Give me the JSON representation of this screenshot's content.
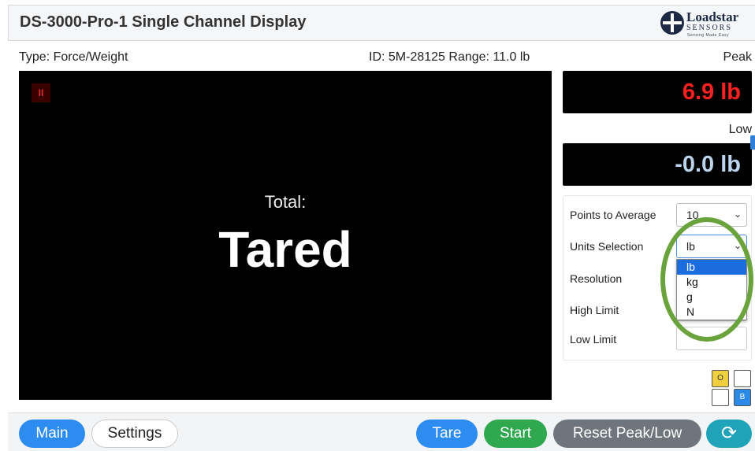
{
  "header": {
    "title": "DS-3000-Pro-1 Single Channel Display",
    "logo": {
      "name": "Loadstar",
      "sub": "SENSORS",
      "tagline": "Sensing Made Easy"
    }
  },
  "info": {
    "type": "Type: Force/Weight",
    "id_range": "ID: 5M-28125 Range: 11.0 lb"
  },
  "display": {
    "pause_glyph": "II",
    "total_label": "Total:",
    "reading": "Tared"
  },
  "peak": {
    "label": "Peak",
    "value": "6.9 lb"
  },
  "low": {
    "label": "Low",
    "value": "-0.0 lb"
  },
  "settings": {
    "points_label": "Points to Average",
    "points_value": "10",
    "units_label": "Units Selection",
    "units_value": "lb",
    "units_options": [
      "lb",
      "kg",
      "g",
      "N"
    ],
    "resolution_label": "Resolution",
    "high_limit_label": "High Limit",
    "low_limit_label": "Low Limit"
  },
  "mini_buttons": {
    "o": "O",
    "b": "B"
  },
  "buttons": {
    "main": "Main",
    "settings": "Settings",
    "tare": "Tare",
    "start": "Start",
    "reset": "Reset Peak/Low",
    "refresh_icon": "refresh-icon"
  },
  "colors": {
    "peak": "#ff2020",
    "low": "#bdd4ee",
    "primary": "#2d8cf0",
    "start": "#2fa84f",
    "reset": "#6e757c",
    "highlight_ring": "#6aa33c"
  }
}
